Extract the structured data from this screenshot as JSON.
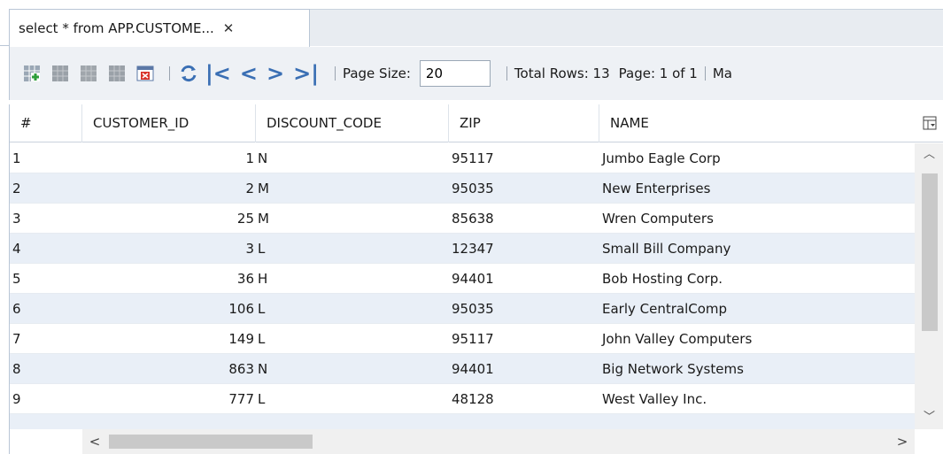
{
  "tab": {
    "title": "select * from APP.CUSTOME...",
    "close_glyph": "✕"
  },
  "toolbar": {
    "icons": [
      "insert-record-icon",
      "delete-record-icon",
      "commit-icon",
      "cancel-edits-icon",
      "truncate-table-icon",
      "refresh-icon",
      "first-page-icon",
      "previous-page-icon",
      "next-page-icon",
      "last-page-icon"
    ],
    "page_size_label": "Page Size:",
    "page_size_value": "20",
    "total_rows_label": "Total Rows: 13",
    "page_label": "Page: 1 of 1",
    "max_label": "Ma"
  },
  "table": {
    "columns": [
      "#",
      "CUSTOMER_ID",
      "DISCOUNT_CODE",
      "ZIP",
      "NAME"
    ],
    "rows": [
      {
        "idx": "1",
        "id": "1",
        "disc": "N",
        "zip": "95117",
        "name": "Jumbo Eagle Corp"
      },
      {
        "idx": "2",
        "id": "2",
        "disc": "M",
        "zip": "95035",
        "name": "New Enterprises"
      },
      {
        "idx": "3",
        "id": "25",
        "disc": "M",
        "zip": "85638",
        "name": "Wren Computers"
      },
      {
        "idx": "4",
        "id": "3",
        "disc": "L",
        "zip": "12347",
        "name": "Small Bill Company"
      },
      {
        "idx": "5",
        "id": "36",
        "disc": "H",
        "zip": "94401",
        "name": "Bob Hosting Corp."
      },
      {
        "idx": "6",
        "id": "106",
        "disc": "L",
        "zip": "95035",
        "name": "Early CentralComp"
      },
      {
        "idx": "7",
        "id": "149",
        "disc": "L",
        "zip": "95117",
        "name": "John Valley Computers"
      },
      {
        "idx": "8",
        "id": "863",
        "disc": "N",
        "zip": "94401",
        "name": "Big Network Systems"
      },
      {
        "idx": "9",
        "id": "777",
        "disc": "L",
        "zip": "48128",
        "name": "West Valley Inc."
      }
    ]
  },
  "colors": {
    "alt_row": "#e9eff7",
    "nav_blue": "#3a6fb4"
  }
}
